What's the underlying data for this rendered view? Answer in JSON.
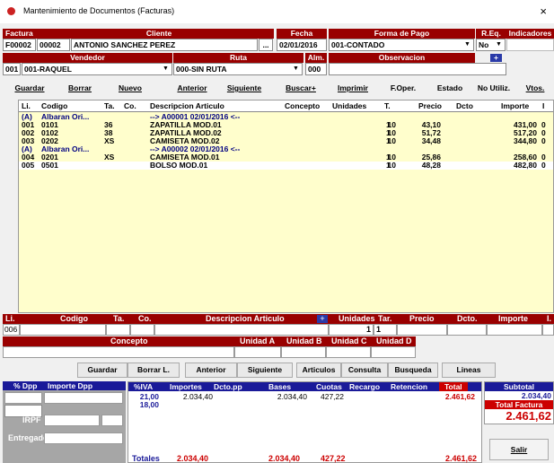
{
  "window": {
    "title": "Mantenimiento de Documentos (Facturas)",
    "close": "×"
  },
  "header": {
    "labels": {
      "factura": "Factura",
      "cliente": "Cliente",
      "fecha": "Fecha",
      "forma_pago": "Forma de Pago",
      "req": "R.Eq.",
      "indicadores": "Indicadores",
      "vendedor": "Vendedor",
      "ruta": "Ruta",
      "alm": "Alm.",
      "observacion": "Observacion",
      "plus": "+"
    },
    "serie": "F00002",
    "numero": "00002",
    "cliente": "ANTONIO SANCHEZ PEREZ",
    "cliente_btn": "...",
    "fecha": "02/01/2016",
    "forma_pago": "001-CONTADO",
    "req": "No",
    "vendedor_code": "001",
    "vendedor": "001-RAQUEL",
    "ruta": "000-SIN RUTA",
    "alm": "000",
    "observacion": ""
  },
  "toolbar": [
    "Guardar",
    "Borrar",
    "Nuevo",
    "Anterior",
    "Siguiente",
    "Buscar+",
    "Imprimir",
    "F.Oper.",
    "Estado",
    "No Utiliz.",
    "Vtos."
  ],
  "grid": {
    "columns": [
      "Li.",
      "Codigo",
      "Ta.",
      "Co.",
      "Descripcion Articulo",
      "Concepto",
      "Unidades",
      "T.",
      "Precio",
      "Dcto",
      "Importe",
      "I"
    ],
    "rows": [
      {
        "li": "(A)",
        "codigo": "Albaran Ori...",
        "ta": "",
        "co": "",
        "desc": "--> A00001 02/01/2016 <--",
        "concepto": "",
        "unidades": "",
        "t": "",
        "precio": "",
        "dcto": "",
        "importe": "",
        "i": ""
      },
      {
        "li": "001",
        "codigo": "0101",
        "ta": "36",
        "co": "",
        "desc": "ZAPATILLA MOD.01",
        "concepto": "",
        "unidades": "10",
        "t": "1",
        "precio": "43,10",
        "dcto": "",
        "importe": "431,00",
        "i": "0"
      },
      {
        "li": "002",
        "codigo": "0102",
        "ta": "38",
        "co": "",
        "desc": "ZAPATILLA MOD.02",
        "concepto": "",
        "unidades": "10",
        "t": "1",
        "precio": "51,72",
        "dcto": "",
        "importe": "517,20",
        "i": "0"
      },
      {
        "li": "003",
        "codigo": "0202",
        "ta": "XS",
        "co": "",
        "desc": "CAMISETA MOD.02",
        "concepto": "",
        "unidades": "10",
        "t": "1",
        "precio": "34,48",
        "dcto": "",
        "importe": "344,80",
        "i": "0"
      },
      {
        "li": "(A)",
        "codigo": "Albaran Ori...",
        "ta": "",
        "co": "",
        "desc": "--> A00002 02/01/2016 <--",
        "concepto": "",
        "unidades": "",
        "t": "",
        "precio": "",
        "dcto": "",
        "importe": "",
        "i": ""
      },
      {
        "li": "004",
        "codigo": "0201",
        "ta": "XS",
        "co": "",
        "desc": "CAMISETA MOD.01",
        "concepto": "",
        "unidades": "10",
        "t": "1",
        "precio": "25,86",
        "dcto": "",
        "importe": "258,60",
        "i": "0"
      },
      {
        "li": "005",
        "codigo": "0501",
        "ta": "",
        "co": "",
        "desc": "BOLSO MOD.01",
        "concepto": "",
        "unidades": "10",
        "t": "1",
        "precio": "48,28",
        "dcto": "",
        "importe": "482,80",
        "i": "0"
      }
    ]
  },
  "entry": {
    "labels": {
      "li": "Li.",
      "codigo": "Codigo",
      "ta": "Ta.",
      "co": "Co.",
      "desc": "Descripcion Articulo",
      "plus": "+",
      "unidades": "Unidades",
      "tar": "Tar.",
      "precio": "Precio",
      "dcto": "Dcto.",
      "importe": "Importe",
      "i": "I.",
      "concepto": "Concepto",
      "ua": "Unidad A",
      "ub": "Unidad B",
      "uc": "Unidad C",
      "ud": "Unidad D"
    },
    "li": "006",
    "unidades": "1",
    "tar": "1"
  },
  "actions": [
    "Guardar",
    "Borrar L.",
    "Anterior",
    "Siguiente",
    "Articulos",
    "Consulta",
    "Busqueda",
    "Lineas"
  ],
  "totals": {
    "labels": {
      "dpp": "% Dpp",
      "imp_dpp": "Importe Dpp",
      "iva": "%IVA",
      "importes": "Importes",
      "dcto_pp": "Dcto.pp",
      "bases": "Bases",
      "cuotas": "Cuotas",
      "recargo": "Recargo",
      "retencion": "Retencion",
      "total": "Total",
      "subtotal": "Subtotal",
      "total_factura": "Total Factura",
      "irpf": "IRPF",
      "entregado": "Entregado",
      "totales": "Totales",
      "salir": "Salir"
    },
    "rows": [
      {
        "iva": "21,00",
        "importes": "2.034,40",
        "bases": "2.034,40",
        "cuotas": "427,22",
        "total": "2.461,62"
      },
      {
        "iva": "18,00",
        "importes": "",
        "bases": "",
        "cuotas": "",
        "total": ""
      }
    ],
    "sum": {
      "importes": "2.034,40",
      "bases": "2.034,40",
      "cuotas": "427,22",
      "total": "2.461,62"
    },
    "subtotal": "2.034,40",
    "total_factura": "2.461,62"
  }
}
